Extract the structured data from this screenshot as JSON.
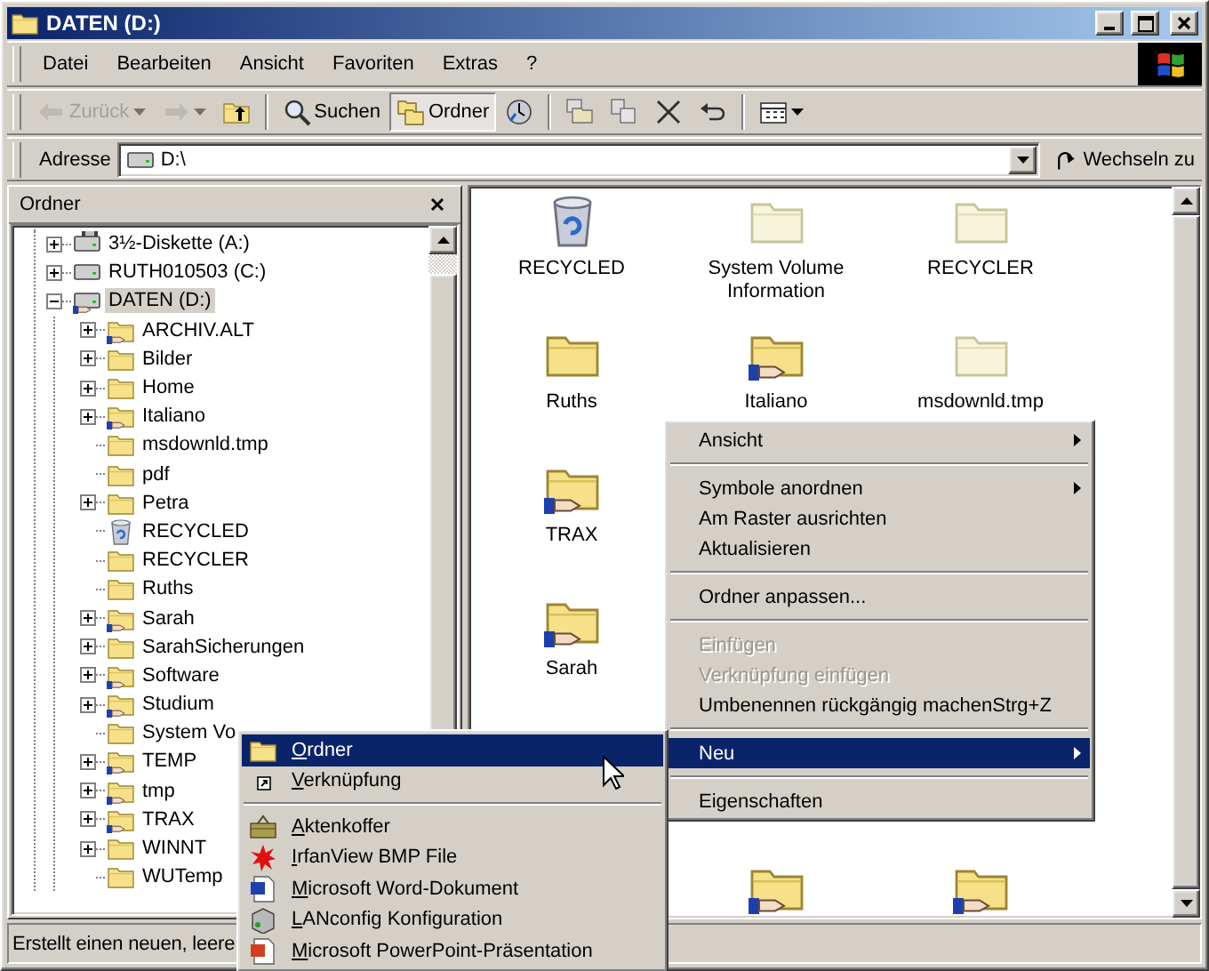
{
  "window": {
    "title": "DATEN (D:)"
  },
  "menu_bar": [
    "Datei",
    "Bearbeiten",
    "Ansicht",
    "Favoriten",
    "Extras",
    "?"
  ],
  "toolbar": [
    {
      "kind": "back",
      "label": "Zurück",
      "disabled": true,
      "pressed": false
    },
    {
      "kind": "forward",
      "disabled": true,
      "pressed": false
    },
    {
      "kind": "up",
      "disabled": false,
      "pressed": false
    },
    {
      "kind": "separator"
    },
    {
      "kind": "search",
      "label": "Suchen",
      "disabled": false,
      "pressed": false
    },
    {
      "kind": "folders",
      "label": "Ordner",
      "disabled": false,
      "pressed": true
    },
    {
      "kind": "history",
      "disabled": false,
      "pressed": false
    },
    {
      "kind": "separator"
    },
    {
      "kind": "move",
      "disabled": false,
      "pressed": false
    },
    {
      "kind": "copy",
      "disabled": false,
      "pressed": false
    },
    {
      "kind": "delete",
      "disabled": false,
      "pressed": false
    },
    {
      "kind": "undo",
      "disabled": false,
      "pressed": false
    },
    {
      "kind": "separator"
    },
    {
      "kind": "views",
      "disabled": false,
      "pressed": false
    }
  ],
  "address_bar": {
    "label": "Adresse",
    "value": "D:\\",
    "go_button": "Wechseln zu"
  },
  "folder_pane": {
    "title": "Ordner",
    "tree": [
      {
        "label": "3½-Diskette (A:)",
        "kind": "floppy",
        "expanded": false,
        "selected": false
      },
      {
        "label": "RUTH010503 (C:)",
        "kind": "drive",
        "expanded": false,
        "selected": false
      },
      {
        "label": "DATEN (D:)",
        "kind": "shared-drive",
        "expanded": true,
        "selected": true,
        "children": [
          {
            "label": "ARCHIV.ALT",
            "kind": "shared-folder",
            "expanded": false,
            "selected": false
          },
          {
            "label": "Bilder",
            "kind": "folder",
            "expanded": false,
            "selected": false
          },
          {
            "label": "Home",
            "kind": "folder",
            "expanded": false,
            "selected": false
          },
          {
            "label": "Italiano",
            "kind": "shared-folder",
            "expanded": false,
            "selected": false
          },
          {
            "label": "msdownld.tmp",
            "kind": "folder",
            "selected": false
          },
          {
            "label": "pdf",
            "kind": "folder",
            "selected": false
          },
          {
            "label": "Petra",
            "kind": "folder",
            "expanded": false,
            "selected": false
          },
          {
            "label": "RECYCLED",
            "kind": "recycle",
            "selected": false
          },
          {
            "label": "RECYCLER",
            "kind": "folder",
            "selected": false
          },
          {
            "label": "Ruths",
            "kind": "folder",
            "selected": false
          },
          {
            "label": "Sarah",
            "kind": "shared-folder",
            "expanded": false,
            "selected": false
          },
          {
            "label": "SarahSicherungen",
            "kind": "folder",
            "expanded": false,
            "selected": false
          },
          {
            "label": "Software",
            "kind": "shared-folder",
            "expanded": false,
            "selected": false
          },
          {
            "label": "Studium",
            "kind": "shared-folder",
            "expanded": false,
            "selected": false
          },
          {
            "label": "System Vo",
            "kind": "folder",
            "selected": false
          },
          {
            "label": "TEMP",
            "kind": "shared-folder",
            "expanded": false,
            "selected": false
          },
          {
            "label": "tmp",
            "kind": "shared-folder",
            "expanded": false,
            "selected": false
          },
          {
            "label": "TRAX",
            "kind": "shared-folder",
            "expanded": false,
            "selected": false
          },
          {
            "label": "WINNT",
            "kind": "folder",
            "expanded": false,
            "selected": false
          },
          {
            "label": "WUTemp",
            "kind": "folder",
            "selected": false
          }
        ]
      }
    ]
  },
  "icon_view": {
    "rows": [
      {
        "icons": [
          {
            "label": "RECYCLED",
            "kind": "recycle",
            "hidden": false
          },
          {
            "label": "System Volume Information",
            "kind": "folder",
            "hidden": true
          },
          {
            "label": "RECYCLER",
            "kind": "folder",
            "hidden": true
          }
        ]
      },
      {
        "icons": [
          {
            "label": "Ruths",
            "kind": "folder",
            "hidden": false
          },
          {
            "label": "Italiano",
            "kind": "shared-folder",
            "hidden": false
          },
          {
            "label": "msdownld.tmp",
            "kind": "folder",
            "hidden": true
          }
        ]
      },
      {
        "icons": [
          {
            "label": "TRAX",
            "kind": "shared-folder",
            "hidden": false
          }
        ]
      },
      {
        "icons": [
          {
            "label": "Sarah",
            "kind": "shared-folder",
            "hidden": false
          }
        ]
      },
      {
        "icons": [
          {
            "kind": "shared-folder",
            "hidden": false
          },
          {
            "kind": "shared-folder",
            "hidden": false
          }
        ]
      }
    ]
  },
  "context_menu": {
    "items": [
      {
        "kind": "item",
        "label": "Ansicht",
        "submenu": true,
        "disabled": false,
        "selected": false
      },
      {
        "kind": "separator"
      },
      {
        "kind": "item",
        "label": "Symbole anordnen",
        "submenu": true,
        "disabled": false,
        "selected": false
      },
      {
        "kind": "item",
        "label": "Am Raster ausrichten",
        "submenu": false,
        "disabled": false,
        "selected": false
      },
      {
        "kind": "item",
        "label": "Aktualisieren",
        "submenu": false,
        "disabled": false,
        "selected": false
      },
      {
        "kind": "separator"
      },
      {
        "kind": "item",
        "label": "Ordner anpassen...",
        "submenu": false,
        "disabled": false,
        "selected": false
      },
      {
        "kind": "separator"
      },
      {
        "kind": "item",
        "label": "Einfügen",
        "submenu": false,
        "disabled": true,
        "selected": false
      },
      {
        "kind": "item",
        "label": "Verknüpfung einfügen",
        "submenu": false,
        "disabled": true,
        "selected": false
      },
      {
        "kind": "item",
        "label": "Umbenennen rückgängig machen",
        "shortcut": "Strg+Z",
        "submenu": false,
        "disabled": false,
        "selected": false
      },
      {
        "kind": "separator"
      },
      {
        "kind": "item",
        "label": "Neu",
        "submenu": true,
        "disabled": false,
        "selected": true
      },
      {
        "kind": "separator"
      },
      {
        "kind": "item",
        "label": "Eigenschaften",
        "submenu": false,
        "disabled": false,
        "selected": false
      }
    ]
  },
  "new_submenu": {
    "items": [
      {
        "kind": "folder",
        "label": "Ordner",
        "selected": true
      },
      {
        "kind": "shortcut",
        "label": "Verknüpfung",
        "selected": false
      },
      {
        "kind": "separator"
      },
      {
        "kind": "briefcase",
        "label": "Aktenkoffer",
        "selected": false
      },
      {
        "kind": "splash",
        "label": "IrfanView BMP File",
        "selected": false
      },
      {
        "kind": "word-doc",
        "label": "Microsoft Word-Dokument",
        "selected": false
      },
      {
        "kind": "device",
        "label": "LANconfig Konfiguration",
        "selected": false
      },
      {
        "kind": "slides-doc",
        "label": "Microsoft PowerPoint-Präsentation",
        "selected": false
      }
    ]
  },
  "status_bar": {
    "text": "Erstellt einen neuen, leere"
  }
}
